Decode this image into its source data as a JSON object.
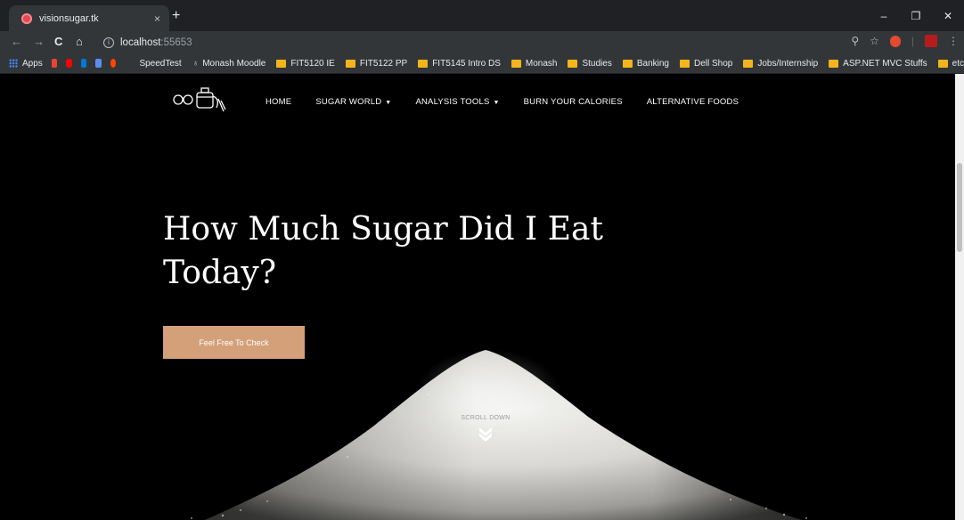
{
  "browser": {
    "tab_title": "visionsugar.tk",
    "tab_close": "×",
    "new_tab": "+",
    "url_host": "localhost",
    "url_port": ":55653",
    "window_controls": {
      "minimize": "–",
      "restore": "❐",
      "close": "✕"
    }
  },
  "bookmarks": [
    {
      "label": "Apps",
      "type": "apps"
    },
    {
      "label": "SpeedTest",
      "type": "text"
    },
    {
      "label": "Monash Moodle",
      "type": "moodle"
    },
    {
      "label": "FIT5120 IE",
      "type": "folder"
    },
    {
      "label": "FIT5122 PP",
      "type": "folder"
    },
    {
      "label": "FIT5145 Intro DS",
      "type": "folder"
    },
    {
      "label": "Monash",
      "type": "folder"
    },
    {
      "label": "Studies",
      "type": "folder"
    },
    {
      "label": "Banking",
      "type": "folder"
    },
    {
      "label": "Dell Shop",
      "type": "folder"
    },
    {
      "label": "Jobs/Internship",
      "type": "folder"
    },
    {
      "label": "ASP.NET MVC Stuffs",
      "type": "folder"
    },
    {
      "label": "etc",
      "type": "folder"
    }
  ],
  "site": {
    "nav": {
      "home": "HOME",
      "sugar_world": "SUGAR WORLD",
      "analysis_tools": "ANALYSIS TOOLS",
      "burn_calories": "BURN YOUR CALORIES",
      "alternative_foods": "ALTERNATIVE FOODS"
    },
    "hero_title": "How Much Sugar Did I Eat Today?",
    "cta_label": "Feel Free To Check",
    "scroll_down": "SCROLL DOWN"
  },
  "colors": {
    "accent": "#d4a07a",
    "chrome_dark": "#202124",
    "chrome_toolbar": "#323639",
    "folder": "#f2b51c"
  }
}
